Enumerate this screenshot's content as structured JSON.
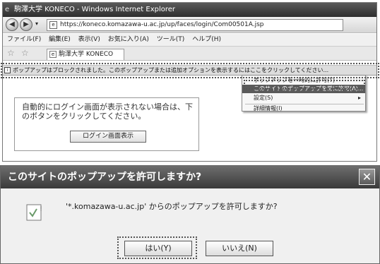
{
  "browser": {
    "title": "駒澤大学 KONECO - Windows Internet Explorer",
    "address": "https://koneco.komazawa-u.ac.jp/up/faces/login/Com00501A.jsp",
    "menu": [
      "ファイル(F)",
      "編集(E)",
      "表示(V)",
      "お気に入り(A)",
      "ツール(T)",
      "ヘルプ(H)"
    ],
    "tab_label": "駒澤大学 KONECO",
    "infobar_text": "ポップアップはブロックされました。このポップアップまたは追加オプションを表示するにはここをクリックしてください...",
    "context_menu": {
      "item1": "ポップアップを一時的に許可(T)",
      "item2": "このサイトのポップアップを常に許可(A)...",
      "item3": "設定(S)",
      "item4": "詳細情報(I)"
    },
    "page": {
      "message": "自動的にログイン画面が表示されない場合は、下のボタンをクリックしてください。",
      "login_button": "ログイン画面表示"
    }
  },
  "dialog": {
    "title": "このサイトのポップアップを許可しますか?",
    "message": "'*.komazawa-u.ac.jp' からのポップアップを許可しますか?",
    "yes_label": "はい(Y)",
    "no_label": "いいえ(N)"
  }
}
